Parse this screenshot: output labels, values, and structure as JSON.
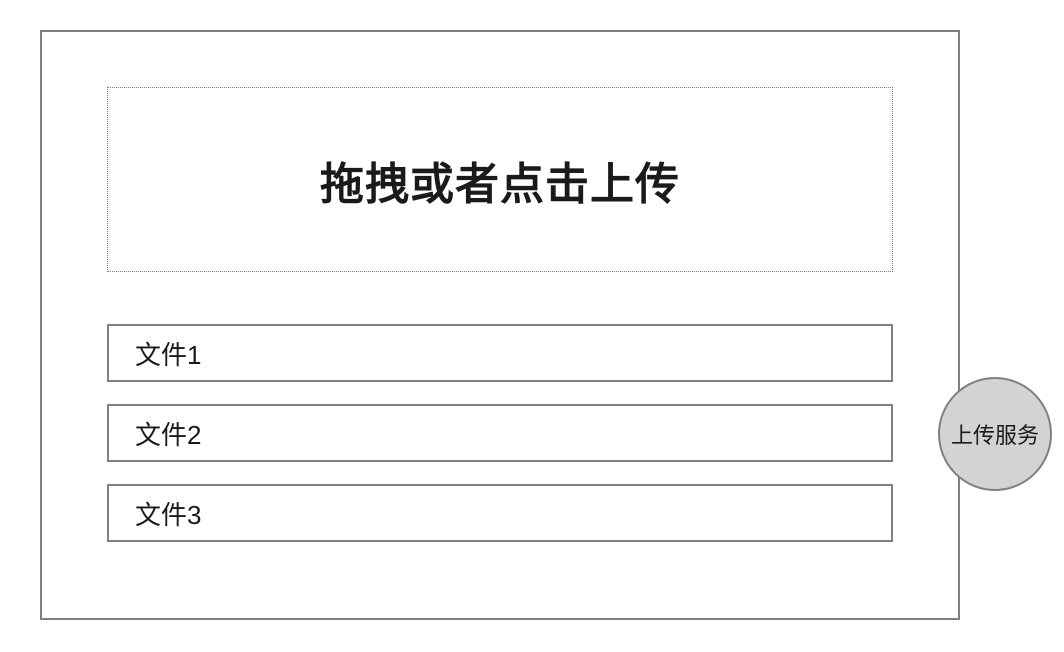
{
  "dropzone": {
    "label": "拖拽或者点击上传"
  },
  "files": [
    {
      "name": "文件1"
    },
    {
      "name": "文件2"
    },
    {
      "name": "文件3"
    }
  ],
  "uploadService": {
    "label": "上传服务"
  }
}
